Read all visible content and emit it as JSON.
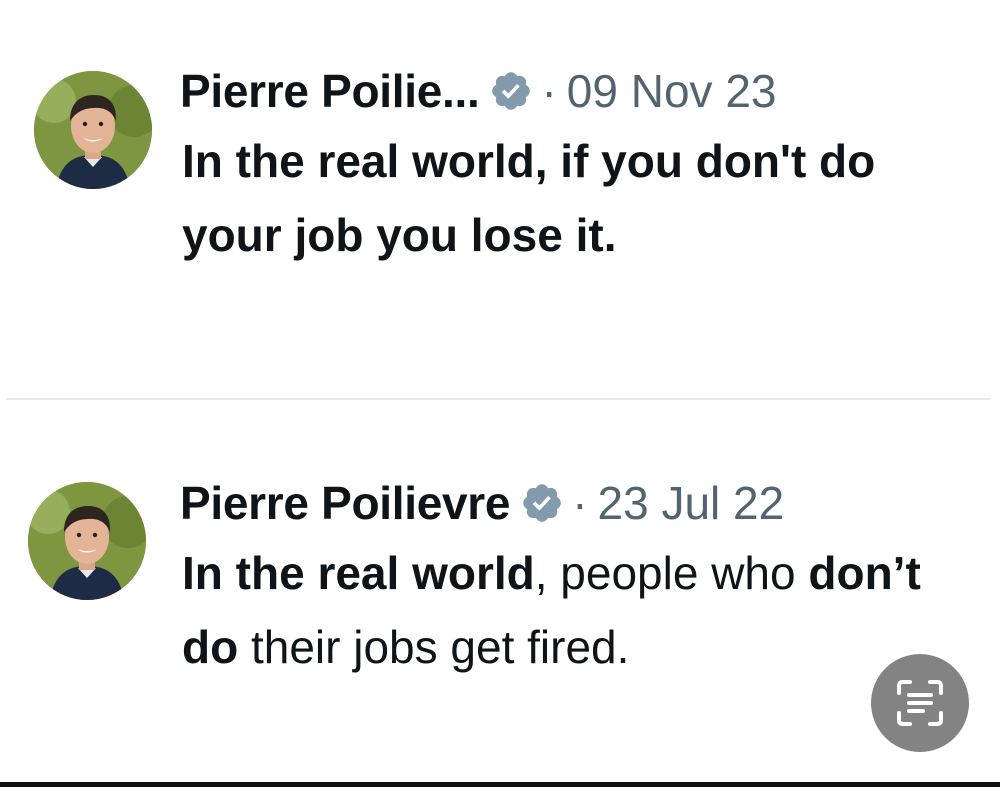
{
  "tweets": [
    {
      "author_name": "Pierre Poilie...",
      "verified": true,
      "separator": "·",
      "date": "09 Nov 23",
      "text": "In the real world, if you don't do your job you lose it."
    },
    {
      "author_name": "Pierre Poilievre",
      "verified": true,
      "separator": "·",
      "date": "23 Jul 22",
      "text_segments": [
        {
          "text": "In the real world",
          "bold": true
        },
        {
          "text": ", people who ",
          "bold": false
        },
        {
          "text": "don’t do",
          "bold": true
        },
        {
          "text": " their jobs get fired.",
          "bold": false
        }
      ]
    }
  ],
  "icons": {
    "verified": "verified-badge-icon",
    "live_text": "live-text-scan-icon"
  },
  "colors": {
    "text": "#0f1419",
    "meta": "#536471",
    "verified_badge": "#829aab",
    "divider": "#e6e9eb",
    "overlay_button": "#787878"
  }
}
